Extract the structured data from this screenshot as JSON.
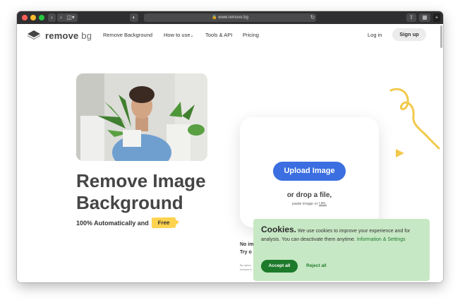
{
  "browser": {
    "url": "www.remove.bg",
    "lock_icon": "lock-icon",
    "traffic_lights": [
      "#ff5f57",
      "#febc2e",
      "#28c840"
    ]
  },
  "nav": {
    "logo_main": "remove",
    "logo_suffix": "bg",
    "links": [
      "Remove Background",
      "How to use",
      "Tools & API",
      "Pricing"
    ],
    "login": "Log in",
    "signup": "Sign up"
  },
  "hero": {
    "title_line1": "Remove Image",
    "title_line2": "Background",
    "subtitle": "100% Automatically and",
    "free_badge": "Free"
  },
  "upload": {
    "button": "Upload Image",
    "drop_text": "or drop a file,",
    "paste_prefix": "paste image or",
    "paste_link": "URL"
  },
  "below_card": {
    "line1": "No im",
    "line2": "Try o",
    "fine1": "By uploa",
    "fine2": "remove.b"
  },
  "cookie": {
    "title": "Cookies.",
    "body": "We use cookies to improve your experience and for analysis. You can deactivate them anytime.",
    "link": "Information & Settings",
    "accept": "Accept all",
    "reject": "Reject all"
  },
  "colors": {
    "accent_blue": "#3b6ee0",
    "badge_yellow": "#ffd34e",
    "cookie_green": "#c7e8c4",
    "accept_green": "#1d7a2a"
  }
}
